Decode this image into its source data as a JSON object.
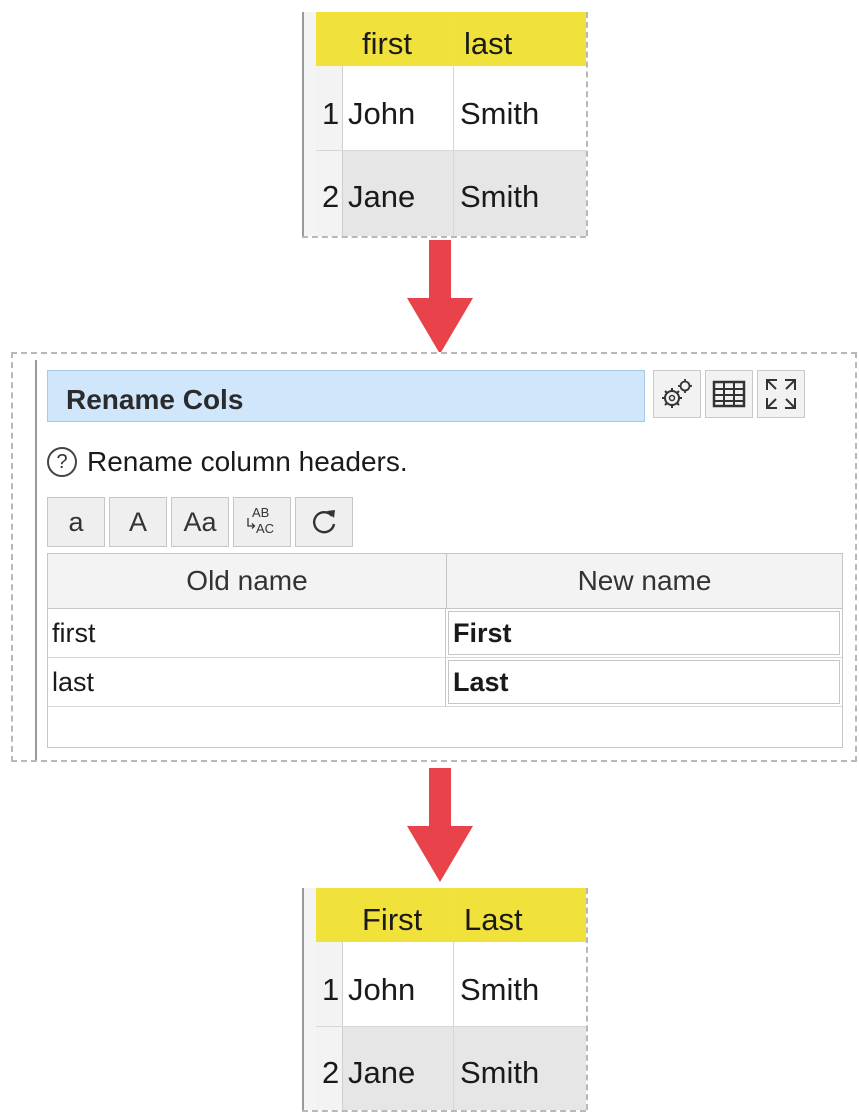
{
  "input_table": {
    "headers": [
      "first",
      "last"
    ],
    "rows": [
      {
        "num": "1",
        "cells": [
          "John",
          "Smith"
        ]
      },
      {
        "num": "2",
        "cells": [
          "Jane",
          "Smith"
        ]
      }
    ]
  },
  "dialog": {
    "title": "Rename Cols",
    "description": "Rename column headers.",
    "help_icon": "?",
    "case_buttons": [
      "a",
      "A",
      "Aa"
    ],
    "icons": [
      "gear-icon",
      "table-icon",
      "maximize-icon",
      "upper-case-icon",
      "reset-icon"
    ],
    "columns": [
      "Old name",
      "New name"
    ],
    "mappings": [
      {
        "old": "first",
        "new": "First"
      },
      {
        "old": "last",
        "new": "Last"
      }
    ]
  },
  "output_table": {
    "headers": [
      "First",
      "Last"
    ],
    "rows": [
      {
        "num": "1",
        "cells": [
          "John",
          "Smith"
        ]
      },
      {
        "num": "2",
        "cells": [
          "Jane",
          "Smith"
        ]
      }
    ]
  },
  "colors": {
    "header_yellow": "#f0e23a",
    "title_blue": "#cfe6fb",
    "arrow_red": "#e8424a",
    "alt_row": "#e6e6e6"
  }
}
